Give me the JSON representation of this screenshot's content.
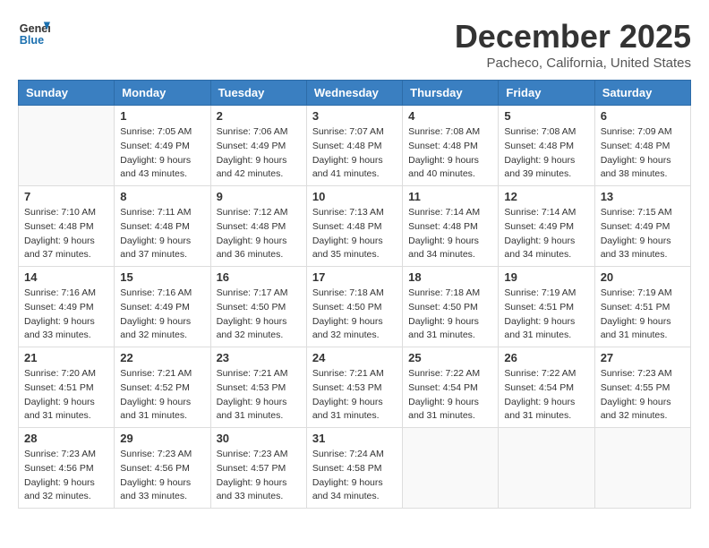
{
  "header": {
    "logo_line1": "General",
    "logo_line2": "Blue",
    "title": "December 2025",
    "location": "Pacheco, California, United States"
  },
  "weekdays": [
    "Sunday",
    "Monday",
    "Tuesday",
    "Wednesday",
    "Thursday",
    "Friday",
    "Saturday"
  ],
  "weeks": [
    [
      {
        "day": "",
        "sunrise": "",
        "sunset": "",
        "daylight": ""
      },
      {
        "day": "1",
        "sunrise": "Sunrise: 7:05 AM",
        "sunset": "Sunset: 4:49 PM",
        "daylight": "Daylight: 9 hours and 43 minutes."
      },
      {
        "day": "2",
        "sunrise": "Sunrise: 7:06 AM",
        "sunset": "Sunset: 4:49 PM",
        "daylight": "Daylight: 9 hours and 42 minutes."
      },
      {
        "day": "3",
        "sunrise": "Sunrise: 7:07 AM",
        "sunset": "Sunset: 4:48 PM",
        "daylight": "Daylight: 9 hours and 41 minutes."
      },
      {
        "day": "4",
        "sunrise": "Sunrise: 7:08 AM",
        "sunset": "Sunset: 4:48 PM",
        "daylight": "Daylight: 9 hours and 40 minutes."
      },
      {
        "day": "5",
        "sunrise": "Sunrise: 7:08 AM",
        "sunset": "Sunset: 4:48 PM",
        "daylight": "Daylight: 9 hours and 39 minutes."
      },
      {
        "day": "6",
        "sunrise": "Sunrise: 7:09 AM",
        "sunset": "Sunset: 4:48 PM",
        "daylight": "Daylight: 9 hours and 38 minutes."
      }
    ],
    [
      {
        "day": "7",
        "sunrise": "Sunrise: 7:10 AM",
        "sunset": "Sunset: 4:48 PM",
        "daylight": "Daylight: 9 hours and 37 minutes."
      },
      {
        "day": "8",
        "sunrise": "Sunrise: 7:11 AM",
        "sunset": "Sunset: 4:48 PM",
        "daylight": "Daylight: 9 hours and 37 minutes."
      },
      {
        "day": "9",
        "sunrise": "Sunrise: 7:12 AM",
        "sunset": "Sunset: 4:48 PM",
        "daylight": "Daylight: 9 hours and 36 minutes."
      },
      {
        "day": "10",
        "sunrise": "Sunrise: 7:13 AM",
        "sunset": "Sunset: 4:48 PM",
        "daylight": "Daylight: 9 hours and 35 minutes."
      },
      {
        "day": "11",
        "sunrise": "Sunrise: 7:14 AM",
        "sunset": "Sunset: 4:48 PM",
        "daylight": "Daylight: 9 hours and 34 minutes."
      },
      {
        "day": "12",
        "sunrise": "Sunrise: 7:14 AM",
        "sunset": "Sunset: 4:49 PM",
        "daylight": "Daylight: 9 hours and 34 minutes."
      },
      {
        "day": "13",
        "sunrise": "Sunrise: 7:15 AM",
        "sunset": "Sunset: 4:49 PM",
        "daylight": "Daylight: 9 hours and 33 minutes."
      }
    ],
    [
      {
        "day": "14",
        "sunrise": "Sunrise: 7:16 AM",
        "sunset": "Sunset: 4:49 PM",
        "daylight": "Daylight: 9 hours and 33 minutes."
      },
      {
        "day": "15",
        "sunrise": "Sunrise: 7:16 AM",
        "sunset": "Sunset: 4:49 PM",
        "daylight": "Daylight: 9 hours and 32 minutes."
      },
      {
        "day": "16",
        "sunrise": "Sunrise: 7:17 AM",
        "sunset": "Sunset: 4:50 PM",
        "daylight": "Daylight: 9 hours and 32 minutes."
      },
      {
        "day": "17",
        "sunrise": "Sunrise: 7:18 AM",
        "sunset": "Sunset: 4:50 PM",
        "daylight": "Daylight: 9 hours and 32 minutes."
      },
      {
        "day": "18",
        "sunrise": "Sunrise: 7:18 AM",
        "sunset": "Sunset: 4:50 PM",
        "daylight": "Daylight: 9 hours and 31 minutes."
      },
      {
        "day": "19",
        "sunrise": "Sunrise: 7:19 AM",
        "sunset": "Sunset: 4:51 PM",
        "daylight": "Daylight: 9 hours and 31 minutes."
      },
      {
        "day": "20",
        "sunrise": "Sunrise: 7:19 AM",
        "sunset": "Sunset: 4:51 PM",
        "daylight": "Daylight: 9 hours and 31 minutes."
      }
    ],
    [
      {
        "day": "21",
        "sunrise": "Sunrise: 7:20 AM",
        "sunset": "Sunset: 4:51 PM",
        "daylight": "Daylight: 9 hours and 31 minutes."
      },
      {
        "day": "22",
        "sunrise": "Sunrise: 7:21 AM",
        "sunset": "Sunset: 4:52 PM",
        "daylight": "Daylight: 9 hours and 31 minutes."
      },
      {
        "day": "23",
        "sunrise": "Sunrise: 7:21 AM",
        "sunset": "Sunset: 4:53 PM",
        "daylight": "Daylight: 9 hours and 31 minutes."
      },
      {
        "day": "24",
        "sunrise": "Sunrise: 7:21 AM",
        "sunset": "Sunset: 4:53 PM",
        "daylight": "Daylight: 9 hours and 31 minutes."
      },
      {
        "day": "25",
        "sunrise": "Sunrise: 7:22 AM",
        "sunset": "Sunset: 4:54 PM",
        "daylight": "Daylight: 9 hours and 31 minutes."
      },
      {
        "day": "26",
        "sunrise": "Sunrise: 7:22 AM",
        "sunset": "Sunset: 4:54 PM",
        "daylight": "Daylight: 9 hours and 31 minutes."
      },
      {
        "day": "27",
        "sunrise": "Sunrise: 7:23 AM",
        "sunset": "Sunset: 4:55 PM",
        "daylight": "Daylight: 9 hours and 32 minutes."
      }
    ],
    [
      {
        "day": "28",
        "sunrise": "Sunrise: 7:23 AM",
        "sunset": "Sunset: 4:56 PM",
        "daylight": "Daylight: 9 hours and 32 minutes."
      },
      {
        "day": "29",
        "sunrise": "Sunrise: 7:23 AM",
        "sunset": "Sunset: 4:56 PM",
        "daylight": "Daylight: 9 hours and 33 minutes."
      },
      {
        "day": "30",
        "sunrise": "Sunrise: 7:23 AM",
        "sunset": "Sunset: 4:57 PM",
        "daylight": "Daylight: 9 hours and 33 minutes."
      },
      {
        "day": "31",
        "sunrise": "Sunrise: 7:24 AM",
        "sunset": "Sunset: 4:58 PM",
        "daylight": "Daylight: 9 hours and 34 minutes."
      },
      {
        "day": "",
        "sunrise": "",
        "sunset": "",
        "daylight": ""
      },
      {
        "day": "",
        "sunrise": "",
        "sunset": "",
        "daylight": ""
      },
      {
        "day": "",
        "sunrise": "",
        "sunset": "",
        "daylight": ""
      }
    ]
  ]
}
